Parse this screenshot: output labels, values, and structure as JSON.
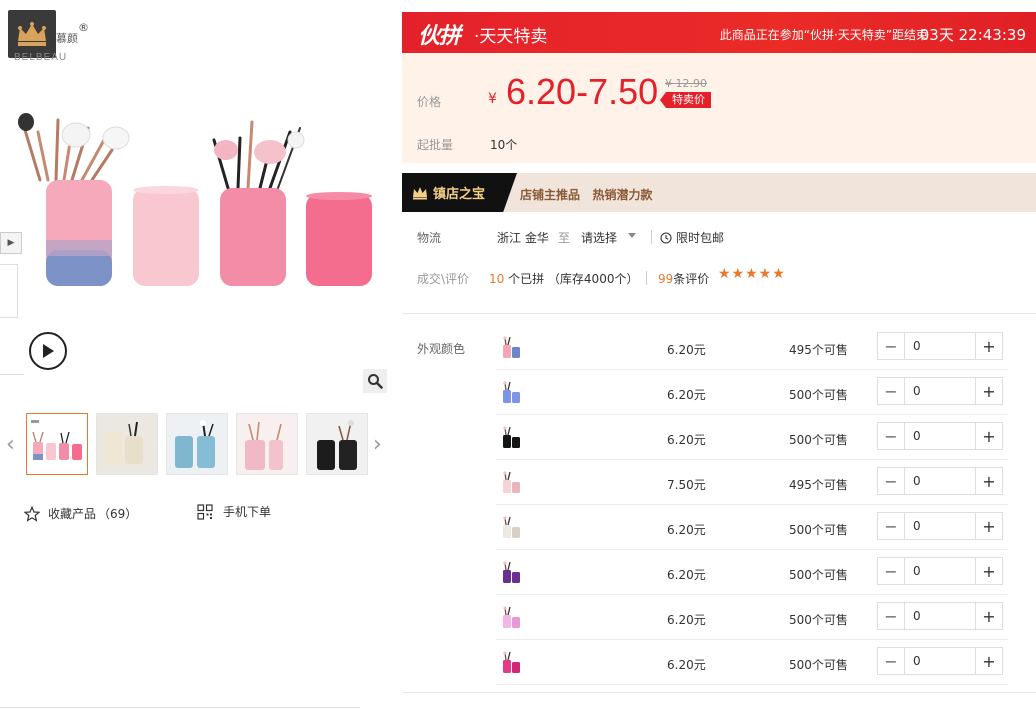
{
  "brand": {
    "name_cn": "慕颜",
    "name_en": "BELBEAU",
    "reg_mark": "®"
  },
  "gallery": {
    "thumbnails": [
      {
        "name": "thumb-pink-blue-set",
        "active": true
      },
      {
        "name": "thumb-cream-set",
        "active": false
      },
      {
        "name": "thumb-blue-set",
        "active": false
      },
      {
        "name": "thumb-pink-gradient-set",
        "active": false
      },
      {
        "name": "thumb-black-set",
        "active": false
      }
    ],
    "prev_arrow": "‹",
    "next_arrow": "›"
  },
  "actions": {
    "favorite_label": "收藏产品",
    "favorite_count": "（69）",
    "mobile_order_label": "手机下单"
  },
  "promo": {
    "brand": "伙拼",
    "title": "·天天特卖",
    "desc": "此商品正在参加“伙拼·天天特卖”距结束",
    "countdown": "03天 22:43:39"
  },
  "price": {
    "label": "价格",
    "currency": "¥",
    "range": "6.20-7.50",
    "original": "¥ 12.90",
    "tag": "特卖价",
    "moq_label": "起批量",
    "moq_value": "10个"
  },
  "treasure": {
    "tag": "镇店之宝",
    "text": "店铺主推品   热销潜力款"
  },
  "shipping": {
    "label": "物流",
    "from": "浙江 金华",
    "to": "至",
    "select": "请选择",
    "free": "限时包邮"
  },
  "deals": {
    "label": "成交\\评价",
    "count": "10",
    "count_suffix": "个已拼 （库存4000个）",
    "reviews": "99",
    "reviews_suffix": "条评价",
    "stars": "★★★★★"
  },
  "sku": {
    "label": "外观颜色",
    "rows": [
      {
        "color": "#f4a6b8",
        "accent": "#6b86c8",
        "price": "6.20元",
        "stock": "495个可售",
        "qty": "0"
      },
      {
        "color": "#7d95e8",
        "accent": "#7d95e8",
        "price": "6.20元",
        "stock": "500个可售",
        "qty": "0"
      },
      {
        "color": "#151515",
        "accent": "#151515",
        "price": "6.20元",
        "stock": "500个可售",
        "qty": "0"
      },
      {
        "color": "#f7d2d6",
        "accent": "#e9b4bb",
        "price": "7.50元",
        "stock": "495个可售",
        "qty": "0"
      },
      {
        "color": "#efe9e4",
        "accent": "#d9cfc6",
        "price": "6.20元",
        "stock": "500个可售",
        "qty": "0"
      },
      {
        "color": "#6a2f8f",
        "accent": "#6a2f8f",
        "price": "6.20元",
        "stock": "500个可售",
        "qty": "0"
      },
      {
        "color": "#f2b7e6",
        "accent": "#e79ad8",
        "price": "6.20元",
        "stock": "500个可售",
        "qty": "0"
      },
      {
        "color": "#e53a86",
        "accent": "#d22775",
        "price": "6.20元",
        "stock": "500个可售",
        "qty": "0"
      }
    ]
  },
  "colors": {
    "accent_red": "#e4212a",
    "accent_orange": "#e8792c",
    "price_panel_bg": "#fff2e9"
  }
}
